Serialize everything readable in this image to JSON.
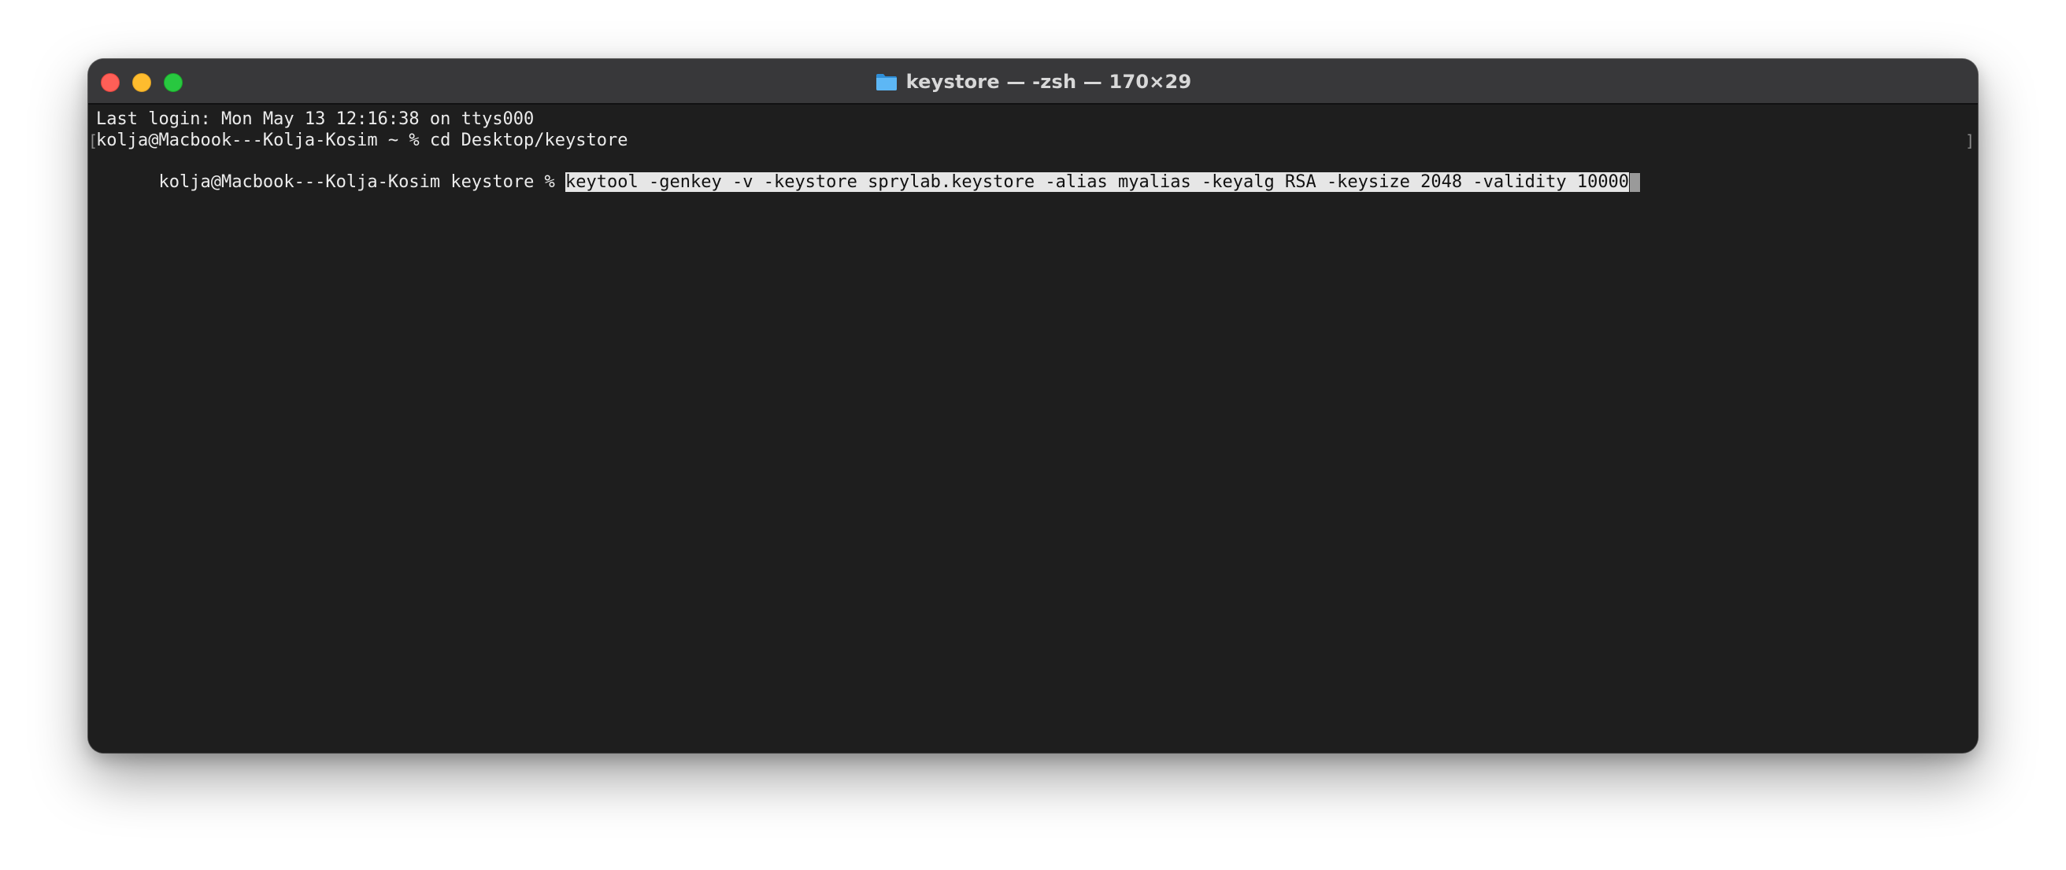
{
  "window": {
    "title": "keystore — -zsh — 170×29",
    "title_icon": "folder-icon",
    "colors": {
      "terminal_background": "#1e1e1e",
      "titlebar_background": "#38383a",
      "text": "#ececec",
      "selection_background": "#e6e6e6",
      "close_button": "#ff5f57",
      "minimize_button": "#febc2e",
      "zoom_button": "#28c840"
    }
  },
  "terminal": {
    "lines": [
      "Last login: Mon May 13 12:16:38 on ttys000",
      "kolja@Macbook---Kolja-Kosim ~ % cd Desktop/keystore"
    ],
    "current_prompt": "kolja@Macbook---Kolja-Kosim keystore % ",
    "current_command": "keytool -genkey -v -keystore sprylab.keystore -alias myalias -keyalg RSA -keysize 2048 -validity 10000",
    "line_markers": {
      "left": "[",
      "right": "]"
    }
  }
}
